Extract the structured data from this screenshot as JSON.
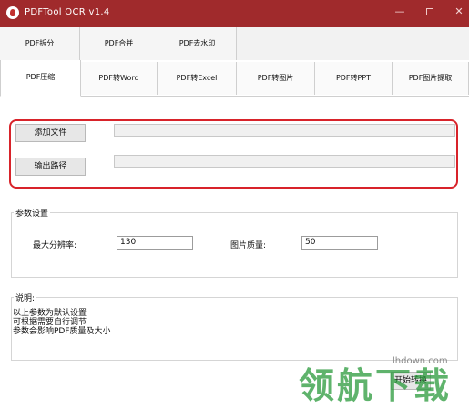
{
  "window": {
    "title": "PDFTool OCR v1.4",
    "controls": {
      "minimize": "—",
      "close": "✕"
    }
  },
  "tabs_row1": [
    "PDF拆分",
    "PDF合并",
    "PDF去水印"
  ],
  "tabs_row2": [
    "PDF压缩",
    "PDF转Word",
    "PDF转Excel",
    "PDF转图片",
    "PDF转PPT",
    "PDF图片提取"
  ],
  "active_tab": "PDF压缩",
  "file_section": {
    "add_file_button": "添加文件",
    "add_file_path": "",
    "output_path_button": "输出路径",
    "output_path": ""
  },
  "params": {
    "title": "参数设置",
    "max_resolution_label": "最大分辨率:",
    "max_resolution_value": "130",
    "image_quality_label": "图片质量:",
    "image_quality_value": "50"
  },
  "notes": {
    "title": "说明:",
    "lines": [
      "以上参数为默认设置",
      "可根据需要自行调节",
      "参数会影响PDF质量及大小"
    ]
  },
  "start_button": "开始转换",
  "watermark": {
    "domain": "lhdown.com",
    "text": "领航下载"
  },
  "colors": {
    "titlebar": "#a02a2c",
    "highlight": "#d8232a",
    "watermark": "#2a9a3c"
  }
}
